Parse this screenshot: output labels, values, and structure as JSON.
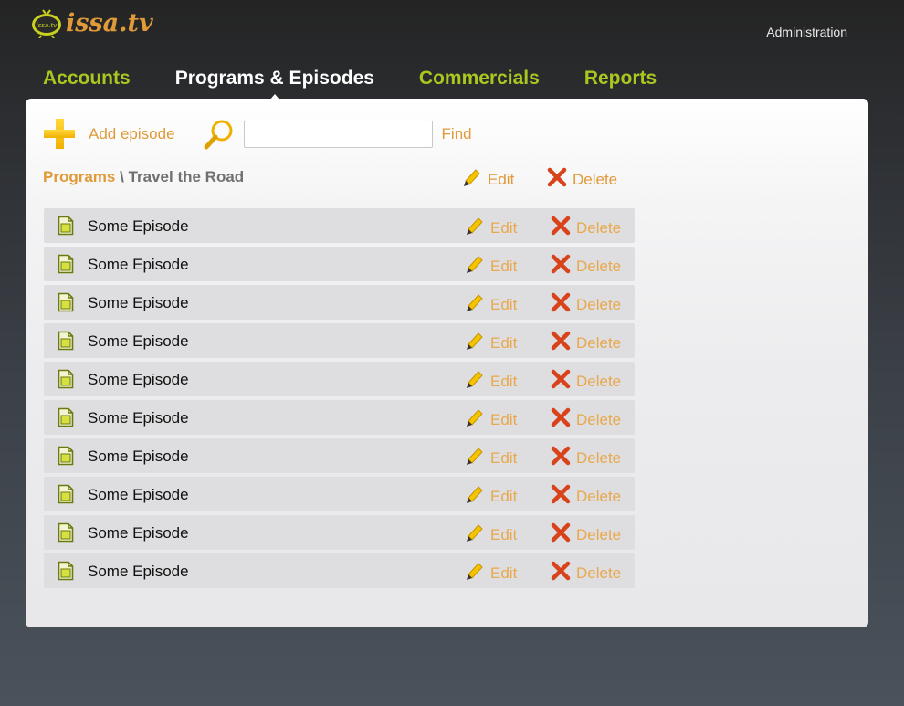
{
  "app": {
    "logo_badge": "issa.tv",
    "logo_text": "issa.tv",
    "admin_link": "Administration"
  },
  "nav": {
    "items": [
      {
        "label": "Accounts",
        "active": false
      },
      {
        "label": "Programs & Episodes",
        "active": true
      },
      {
        "label": "Commercials",
        "active": false
      },
      {
        "label": "Reports",
        "active": false
      }
    ]
  },
  "toolbar": {
    "add_label": "Add episode",
    "search_value": "",
    "search_placeholder": "",
    "find_label": "Find"
  },
  "breadcrumb": {
    "link": "Programs",
    "separator": "\\",
    "current": "Travel the Road"
  },
  "header_actions": {
    "edit_label": "Edit",
    "delete_label": "Delete"
  },
  "episodes": [
    {
      "title": "Some Episode",
      "edit": "Edit",
      "delete": "Delete"
    },
    {
      "title": "Some Episode",
      "edit": "Edit",
      "delete": "Delete"
    },
    {
      "title": "Some Episode",
      "edit": "Edit",
      "delete": "Delete"
    },
    {
      "title": "Some Episode",
      "edit": "Edit",
      "delete": "Delete"
    },
    {
      "title": "Some Episode",
      "edit": "Edit",
      "delete": "Delete"
    },
    {
      "title": "Some Episode",
      "edit": "Edit",
      "delete": "Delete"
    },
    {
      "title": "Some Episode",
      "edit": "Edit",
      "delete": "Delete"
    },
    {
      "title": "Some Episode",
      "edit": "Edit",
      "delete": "Delete"
    },
    {
      "title": "Some Episode",
      "edit": "Edit",
      "delete": "Delete"
    },
    {
      "title": "Some Episode",
      "edit": "Edit",
      "delete": "Delete"
    }
  ],
  "colors": {
    "accent": "#e09a3a",
    "nav_green": "#a8c820",
    "row_bg": "#dedee0",
    "delete_red": "#d8431c"
  },
  "icons": [
    "tv-logo-icon",
    "plus-icon",
    "magnifier-icon",
    "pencil-icon",
    "delete-x-icon",
    "document-icon"
  ]
}
